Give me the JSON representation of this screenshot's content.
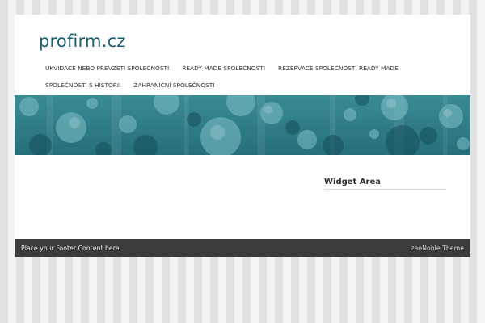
{
  "site": {
    "title": "profirm.cz"
  },
  "nav": {
    "items": [
      {
        "label": "UKVIDACE NEBO PŘEVZETÍ SPOLEČNOSTI"
      },
      {
        "label": "READY MADE SPOLEČNOSTI"
      },
      {
        "label": "REZERVACE SPOLEČNOSTI READY MADE"
      },
      {
        "label": "SPOLEČNOSTI S HISTORIÍ"
      },
      {
        "label": "ZAHRANIČNÍ SPOLEČNOSTI"
      }
    ]
  },
  "banner": {
    "colors": {
      "base": "#2f7e89",
      "bubble_light": "#6fb4bb",
      "bubble_dark": "#1a5c66"
    }
  },
  "sidebar": {
    "widget_title": "Widget Area"
  },
  "footer": {
    "left_text": "Place your Footer Content here",
    "right_text": "zeeNoble Theme"
  },
  "colors": {
    "title": "#1d5f70",
    "footer_bg": "#3b3b3b"
  }
}
